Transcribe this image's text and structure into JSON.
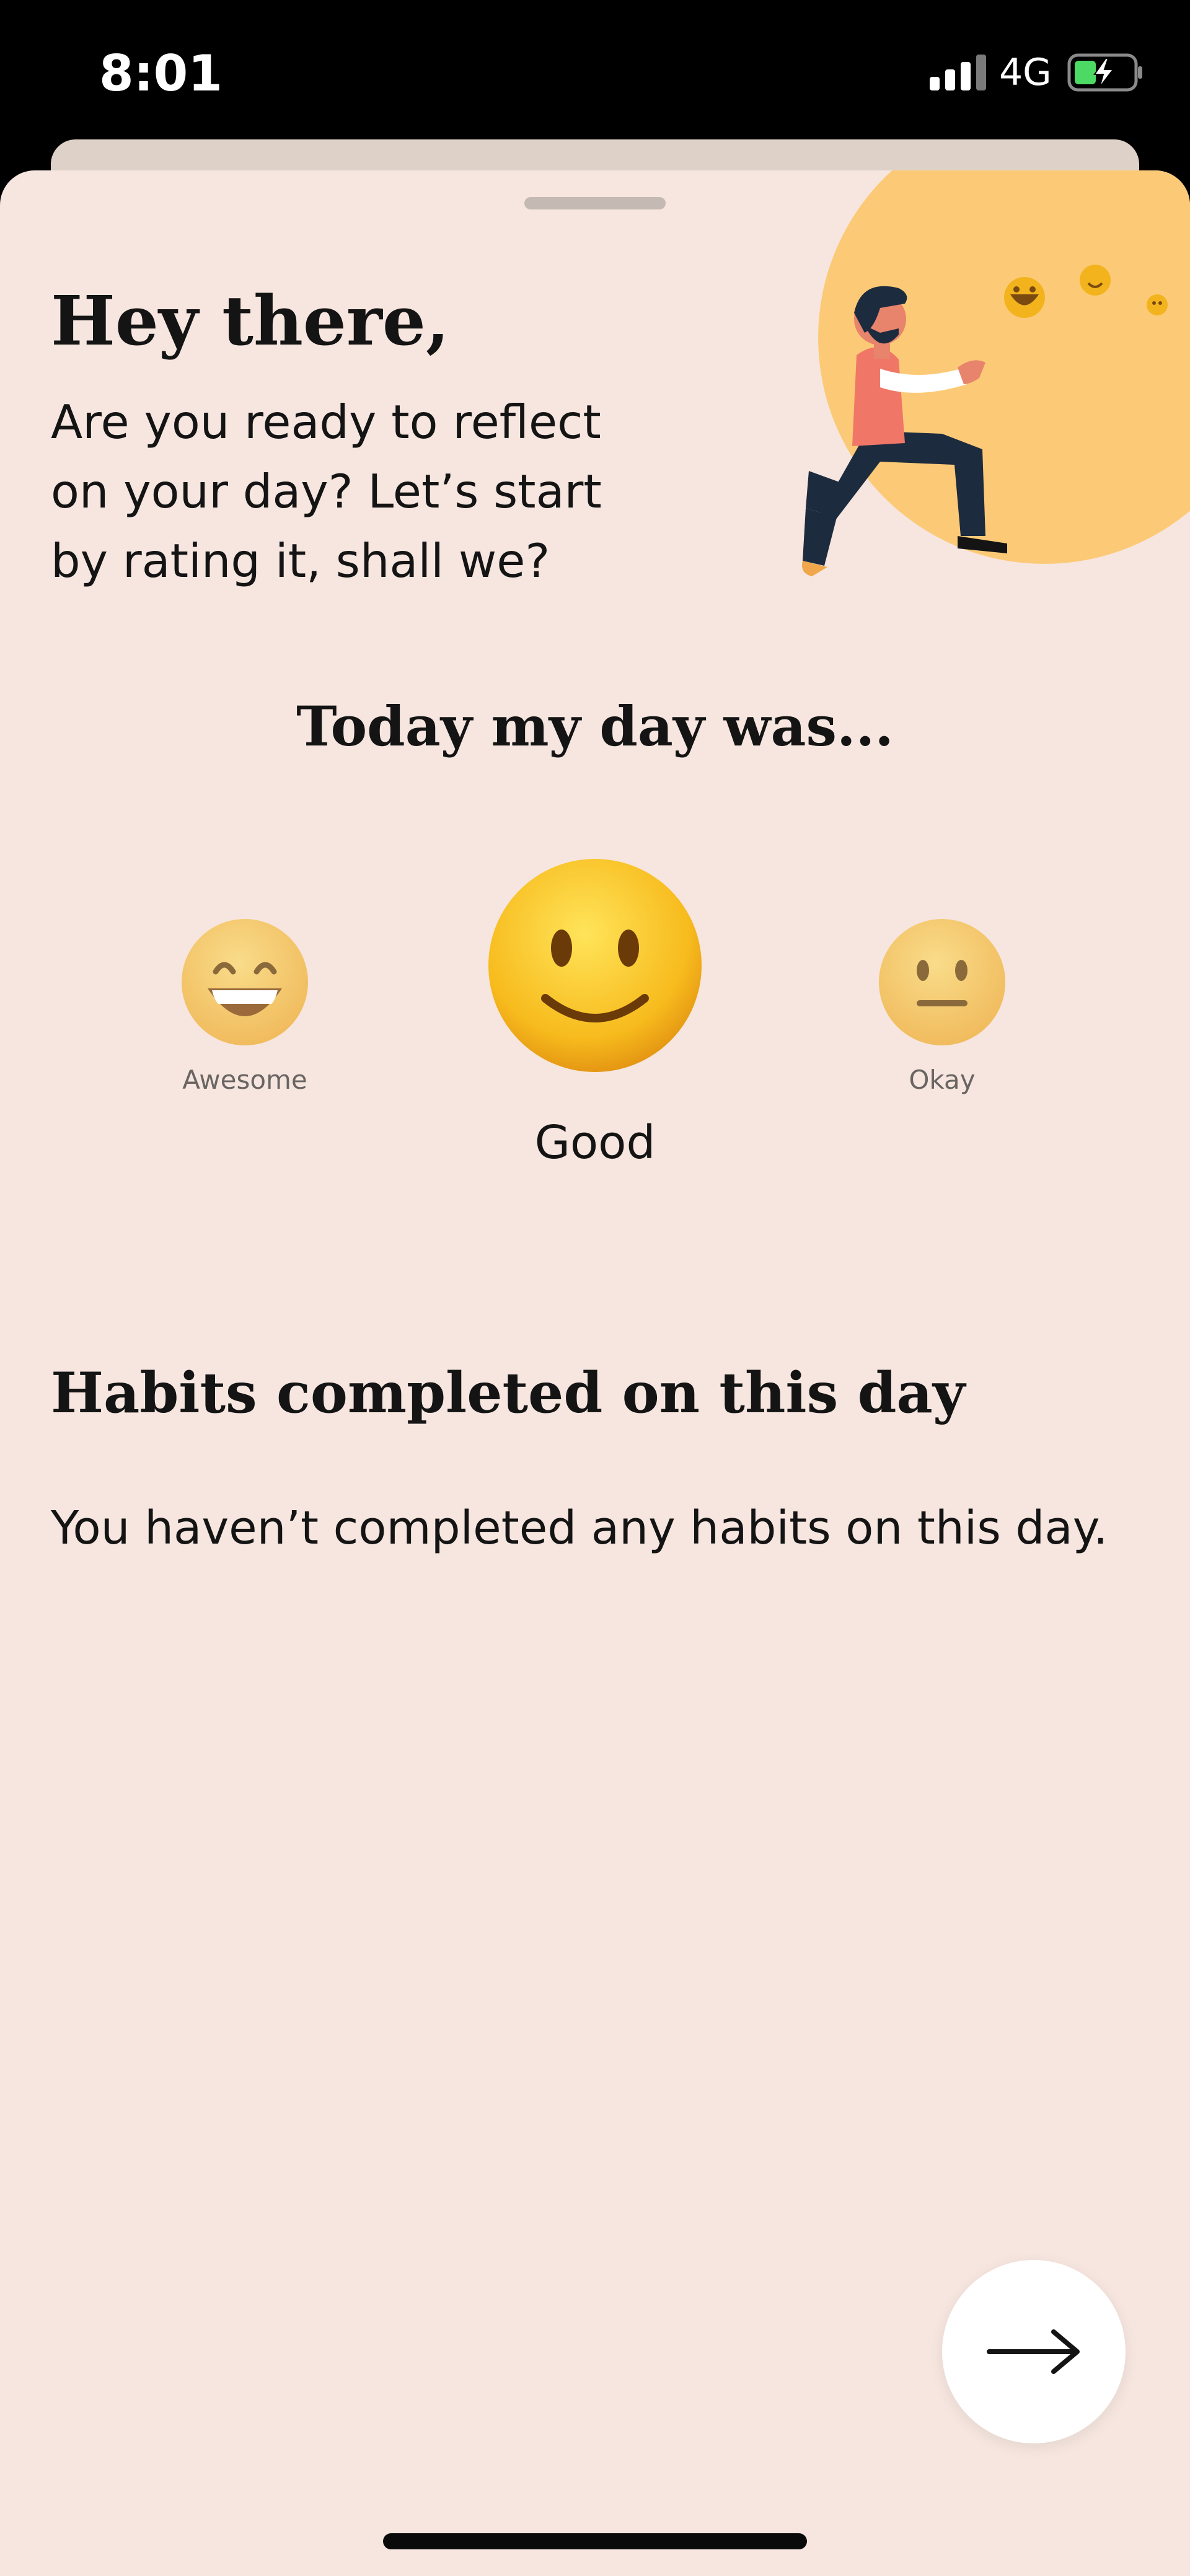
{
  "status_bar": {
    "time": "8:01",
    "network": "4G"
  },
  "greeting": {
    "title": "Hey there,",
    "body": "Are you ready to reflect on your day? Let’s start by rating it, shall we?"
  },
  "rating": {
    "heading": "Today my day was...",
    "options": [
      {
        "label": "Awesome",
        "icon": "grinning-face-icon",
        "selected": false
      },
      {
        "label": "Good",
        "icon": "slightly-smiling-face-icon",
        "selected": true
      },
      {
        "label": "Okay",
        "icon": "neutral-face-icon",
        "selected": false
      }
    ]
  },
  "habits": {
    "heading": "Habits completed on this day",
    "empty_message": "You haven’t completed any habits on this day."
  },
  "next_button": {
    "icon": "arrow-right-icon"
  },
  "colors": {
    "background": "#f6e6df",
    "illustration_circle": "#fcca77",
    "text": "#141414",
    "emoji_yellow": "#f7bb1d"
  }
}
